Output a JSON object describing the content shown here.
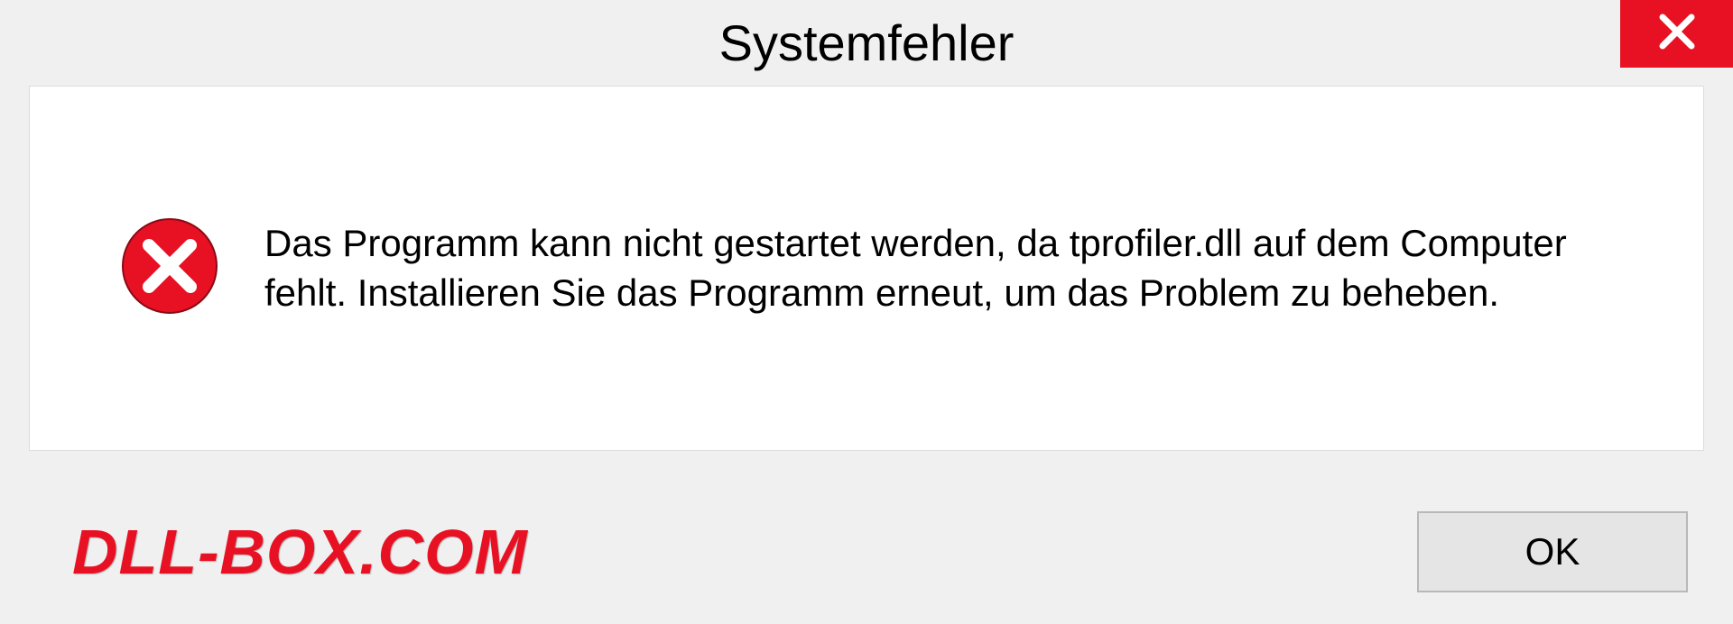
{
  "dialog": {
    "title": "Systemfehler",
    "message": "Das Programm kann nicht gestartet werden, da tprofiler.dll auf dem Computer fehlt. Installieren Sie das Programm erneut, um das Problem zu beheben.",
    "ok_label": "OK"
  },
  "watermark": "DLL-BOX.COM"
}
